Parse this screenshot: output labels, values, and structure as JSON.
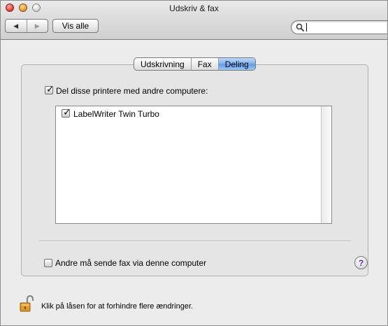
{
  "window": {
    "title": "Udskriv & fax"
  },
  "toolbar": {
    "back_glyph": "◀",
    "forward_glyph": "▶",
    "show_all_label": "Vis alle",
    "search_value": "",
    "search_placeholder": ""
  },
  "tabs": [
    {
      "label": "Udskrivning",
      "active": false
    },
    {
      "label": "Fax",
      "active": false
    },
    {
      "label": "Deling",
      "active": true
    }
  ],
  "sharing": {
    "share_printers_label": "Del disse printere med andre computere:",
    "share_printers_checked": true,
    "printers": [
      {
        "name": "LabelWriter Twin Turbo",
        "checked": true
      }
    ],
    "fax_label": "Andre må sende fax via denne computer",
    "fax_checked": false
  },
  "help": {
    "glyph": "?"
  },
  "lock": {
    "message": "Klik på låsen for at forhindre flere ændringer."
  },
  "colors": {
    "active_tab": "#7fb1ee",
    "window_bg": "#ececec",
    "help_glyph": "#5a2ca0"
  },
  "icons": {
    "close": "close-icon",
    "minimize": "minimize-icon",
    "zoom": "zoom-icon",
    "search": "search-icon",
    "lock": "lock-icon",
    "help": "help-icon"
  }
}
